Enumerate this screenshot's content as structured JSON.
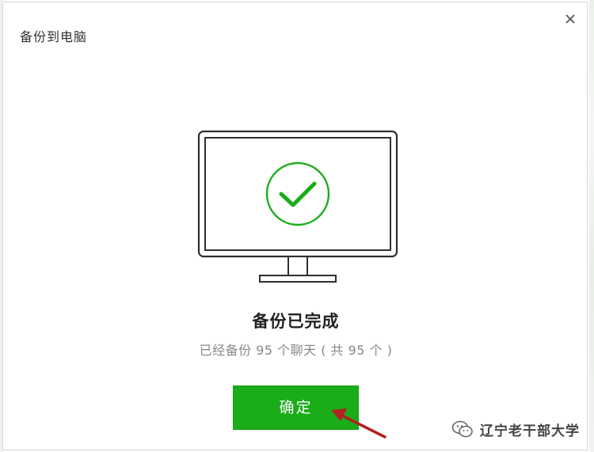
{
  "dialog": {
    "title": "备份到电脑",
    "close_icon": "close-icon",
    "illustration_icon": "monitor-check-icon",
    "status_title": "备份已完成",
    "status_detail": "已经备份 95 个聊天 ( 共 95 个 )",
    "ok_label": "确定",
    "accent_color": "#1aad19",
    "annotation_color": "#b22222"
  },
  "watermark": {
    "text": "辽宁老干部大学",
    "icon": "wechat-logo-icon"
  }
}
